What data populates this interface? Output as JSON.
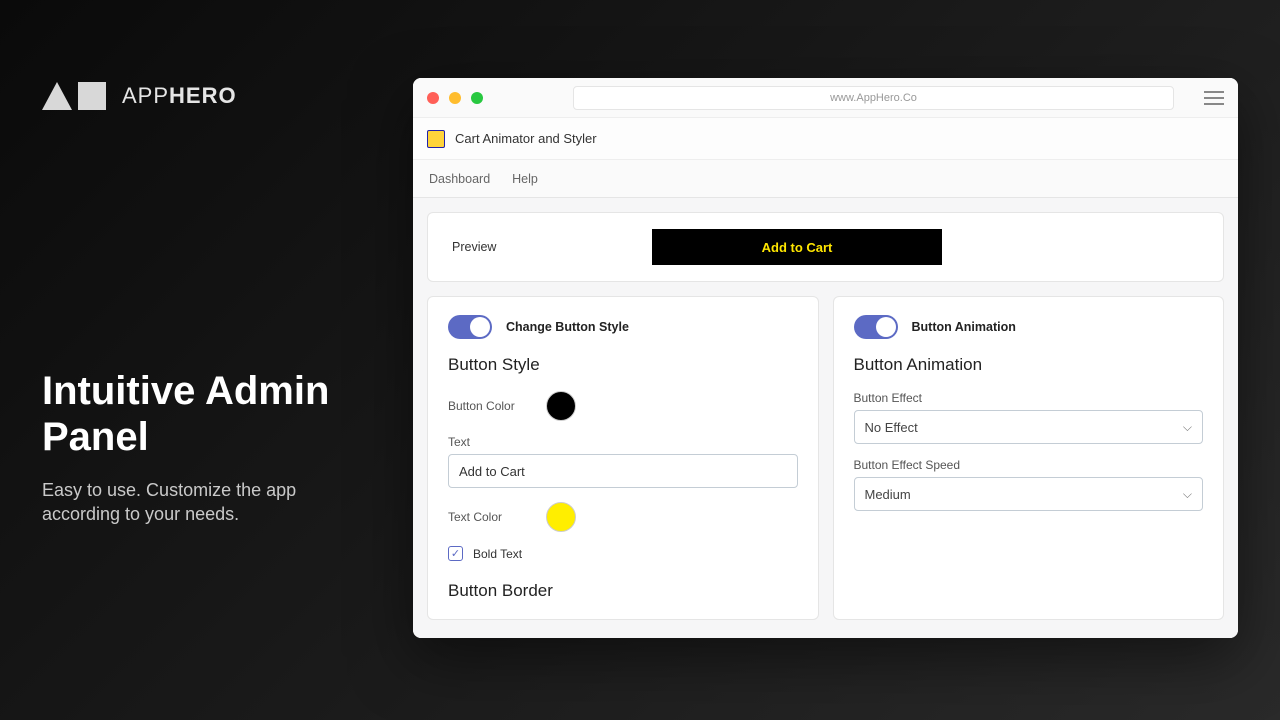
{
  "brand": {
    "light": "APP",
    "bold": "HERO"
  },
  "hero": {
    "title": "Intuitive Admin Panel",
    "subtitle": "Easy to use. Customize the app according to your needs."
  },
  "browser": {
    "url": "www.AppHero.Co",
    "app_title": "Cart Animator and Styler"
  },
  "nav": {
    "dashboard": "Dashboard",
    "help": "Help"
  },
  "preview": {
    "label": "Preview",
    "button_text": "Add to Cart",
    "button_bg": "#000000",
    "button_color": "#ffe600"
  },
  "style_card": {
    "toggle_label": "Change Button Style",
    "heading": "Button Style",
    "button_color_label": "Button Color",
    "button_color": "#000000",
    "text_label": "Text",
    "text_value": "Add to Cart",
    "text_color_label": "Text Color",
    "text_color": "#ffee00",
    "bold_label": "Bold Text",
    "border_heading": "Button Border"
  },
  "anim_card": {
    "toggle_label": "Button Animation",
    "heading": "Button Animation",
    "effect_label": "Button Effect",
    "effect_value": "No Effect",
    "speed_label": "Button Effect Speed",
    "speed_value": "Medium"
  }
}
